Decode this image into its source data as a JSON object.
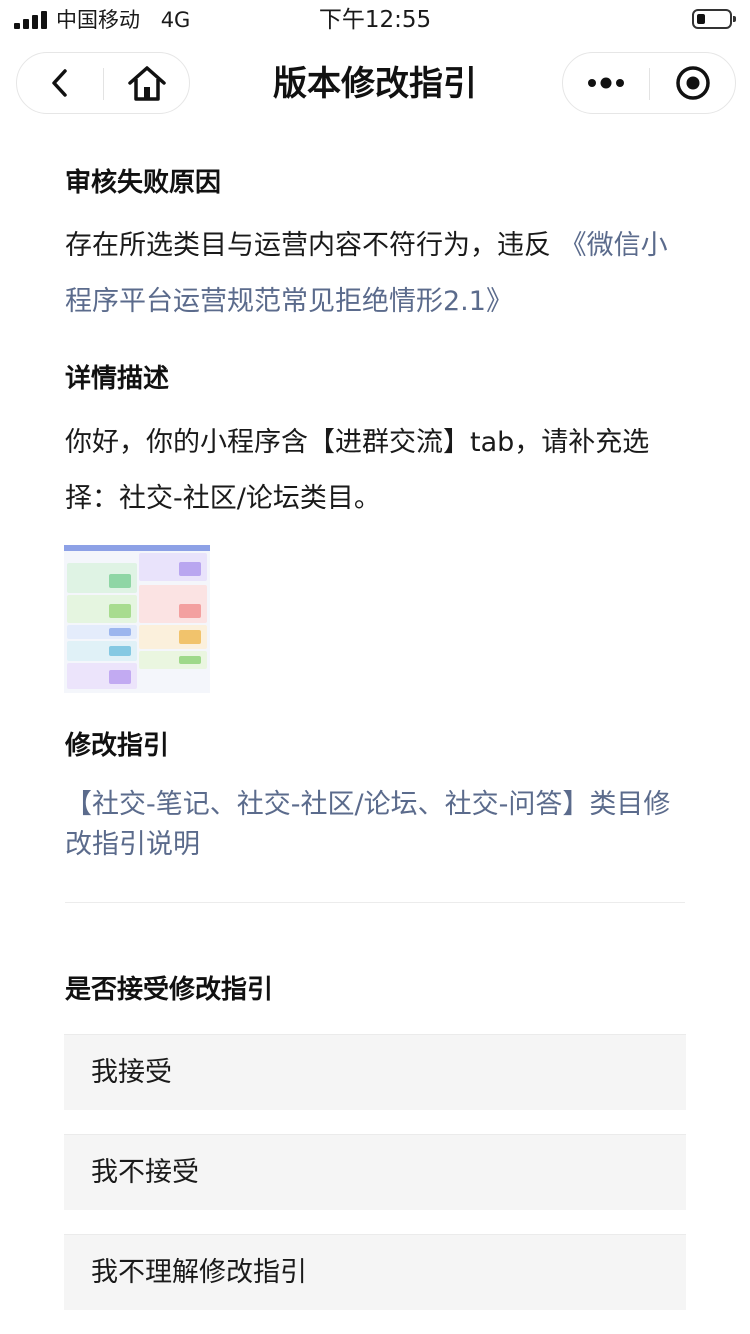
{
  "status_bar": {
    "carrier": "中国移动",
    "network": "4G",
    "time": "下午12:55"
  },
  "nav": {
    "title": "版本修改指引",
    "back_icon": "chevron-left-icon",
    "home_icon": "home-icon",
    "more_icon": "more-dots-icon",
    "close_icon": "target-circle-icon"
  },
  "rejection": {
    "heading": "审核失败原因",
    "text": "存在所选类目与运营内容不符行为，违反",
    "link": "《微信小程序平台运营规范常见拒绝情形2.1》"
  },
  "details": {
    "heading": "详情描述",
    "text": "你好，你的小程序含【进群交流】tab，请补充选择：社交-社区/论坛类目。"
  },
  "guide": {
    "heading": "修改指引",
    "link": "【社交-笔记、社交-社区/论坛、社交-问答】类目修改指引说明"
  },
  "accept": {
    "heading": "是否接受修改指引",
    "options": [
      "我接受",
      "我不接受",
      "我不理解修改指引"
    ]
  },
  "colors": {
    "link": "#5b6b8c",
    "option_bg": "#f5f5f5"
  }
}
